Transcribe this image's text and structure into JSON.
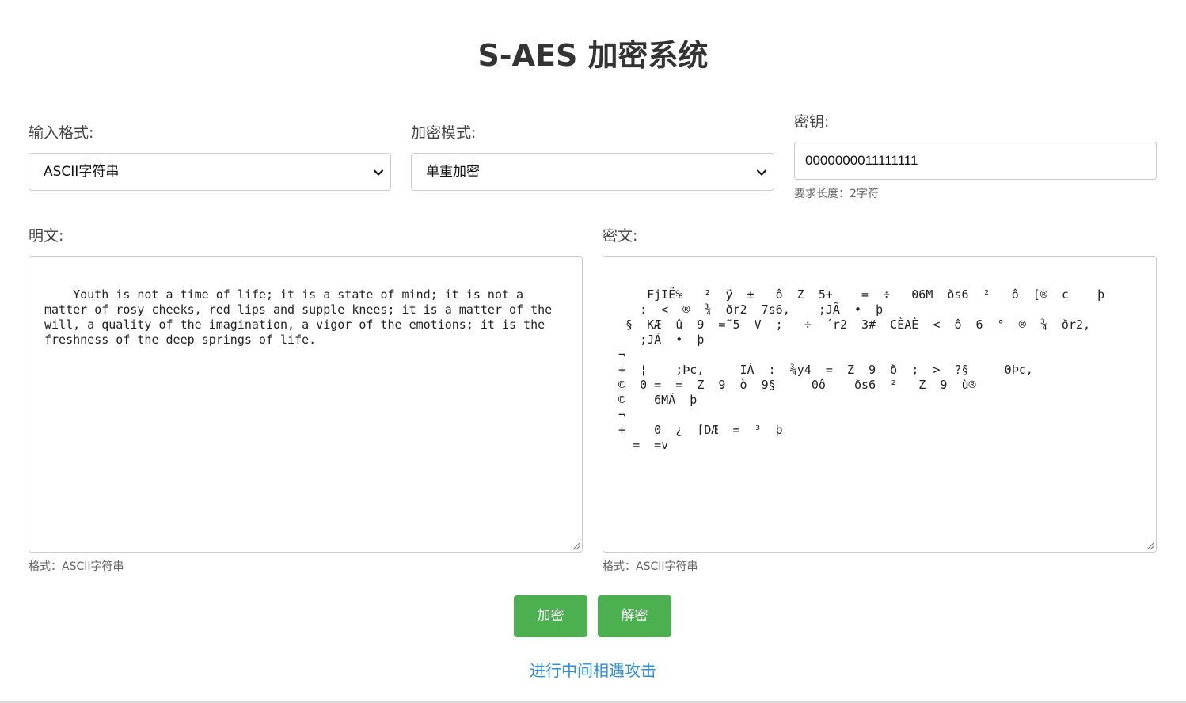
{
  "page": {
    "title": "S-AES 加密系统"
  },
  "input_format": {
    "label": "输入格式:",
    "selected": "ASCII字符串"
  },
  "encryption_mode": {
    "label": "加密模式:",
    "selected": "单重加密"
  },
  "key": {
    "label": "密钥:",
    "value": "0000000011111111",
    "hint": "要求长度：2字符"
  },
  "plaintext": {
    "label": "明文:",
    "value": "Youth is not a time of life; it is a state of mind; it is not a matter of rosy cheeks, red lips and supple knees; it is a matter of the will, a quality of the imagination, a vigor of the emotions; it is the freshness of the deep springs of life.",
    "format_hint": "格式：ASCII字符串"
  },
  "ciphertext": {
    "label": "密文:",
    "value": "FjIË%   ²  ÿ  ±   ô  Z  5+    =  ÷   06M  ðs6  ²   ô  [®  ¢    þ\n   :  <  ®  ¾  ðr2  7s6,    ;JÃ  •  þ\n §  KÆ  û  9  =˜5  V  ;   ÷  ´r2  3#  CÈAÈ  <  ô  6  °  ®  ¾  ðr2,\n   ;JÃ  •  þ\n¬\n+  ¦    ;Þc,     IÁ  :  ¾y4  =  Z  9  ð  ;  >  ?§     0Þc,\n©  0 =  =  Z  9  ò  9§     0ô    ðs6  ²   Z  9  ù®\n©    6MÃ  þ\n¬\n+    0  ¿  [DÆ  =  ³  þ\n  =  =v",
    "format_hint": "格式：ASCII字符串"
  },
  "actions": {
    "encrypt_label": "加密",
    "decrypt_label": "解密",
    "attack_link": "进行中间相遇攻击"
  },
  "icons": {
    "select_chevron": "chevron-down-icon",
    "resize_grip": "resize-grip-icon"
  },
  "colors": {
    "primary_button": "#4caf50",
    "link": "#2f8fd8"
  }
}
